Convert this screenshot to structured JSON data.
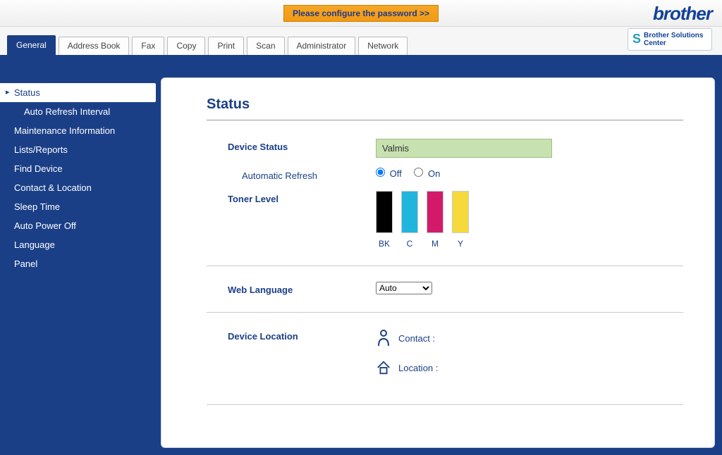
{
  "banner": {
    "config_password_label": "Please configure the password >>",
    "logo_text": "brother",
    "solutions_center_label": "Brother Solutions Center"
  },
  "tabs": [
    {
      "label": "General",
      "active": true
    },
    {
      "label": "Address Book",
      "active": false
    },
    {
      "label": "Fax",
      "active": false
    },
    {
      "label": "Copy",
      "active": false
    },
    {
      "label": "Print",
      "active": false
    },
    {
      "label": "Scan",
      "active": false
    },
    {
      "label": "Administrator",
      "active": false
    },
    {
      "label": "Network",
      "active": false
    }
  ],
  "sidebar": {
    "items": [
      {
        "label": "Status",
        "active": true,
        "sub": false
      },
      {
        "label": "Auto Refresh Interval",
        "active": false,
        "sub": true
      },
      {
        "label": "Maintenance Information",
        "active": false,
        "sub": false
      },
      {
        "label": "Lists/Reports",
        "active": false,
        "sub": false
      },
      {
        "label": "Find Device",
        "active": false,
        "sub": false
      },
      {
        "label": "Contact & Location",
        "active": false,
        "sub": false
      },
      {
        "label": "Sleep Time",
        "active": false,
        "sub": false
      },
      {
        "label": "Auto Power Off",
        "active": false,
        "sub": false
      },
      {
        "label": "Language",
        "active": false,
        "sub": false
      },
      {
        "label": "Panel",
        "active": false,
        "sub": false
      }
    ]
  },
  "main": {
    "title": "Status",
    "device_status_label": "Device Status",
    "device_status_value": "Valmis",
    "auto_refresh_label": "Automatic Refresh",
    "auto_refresh": {
      "off_label": "Off",
      "on_label": "On",
      "selected": "Off"
    },
    "toner_level_label": "Toner Level",
    "toner": [
      {
        "code": "BK",
        "color": "#000000",
        "level": 100
      },
      {
        "code": "C",
        "color": "#1fb5dd",
        "level": 100
      },
      {
        "code": "M",
        "color": "#d31a6a",
        "level": 100
      },
      {
        "code": "Y",
        "color": "#f6d93a",
        "level": 100
      }
    ],
    "web_language_label": "Web Language",
    "web_language_value": "Auto",
    "device_location_label": "Device Location",
    "contact_label": "Contact :",
    "contact_value": "",
    "location_label": "Location :",
    "location_value": ""
  }
}
